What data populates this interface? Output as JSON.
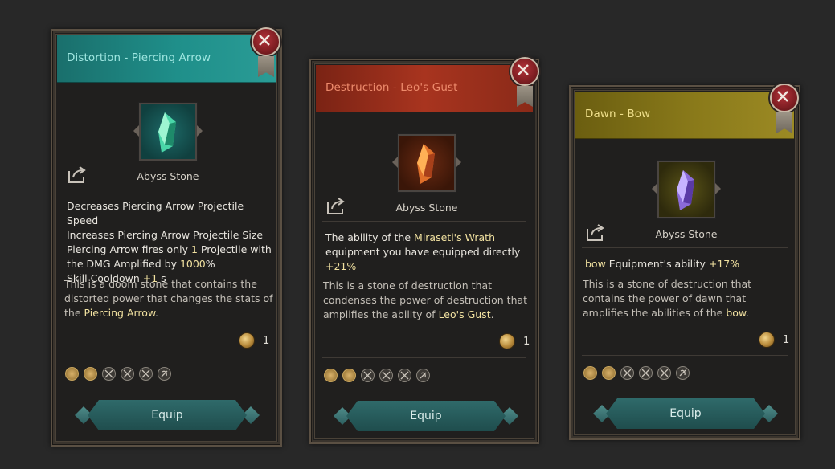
{
  "cards": [
    {
      "title": "Distortion - Piercing Arrow",
      "item_name": "Abyss Stone",
      "effect_lines": [
        "Decreases Piercing Arrow Projectile Speed",
        "Increases Piercing Arrow Projectile Size",
        "Piercing Arrow fires only ",
        "1",
        " Projectile with",
        "the DMG Amplified by ",
        "1000",
        "%",
        "Skill Cooldown ",
        "+1",
        " s"
      ],
      "description_parts": [
        "This is a doom stone that contains the distorted power that changes the stats of the ",
        "Piercing Arrow",
        "."
      ],
      "cost": "1",
      "equip_label": "Equip",
      "theme_color": "#1f8f8f",
      "title_color": "#9ee6e0"
    },
    {
      "title": "Destruction - Leo's Gust",
      "item_name": "Abyss Stone",
      "effect_parts": [
        "The ability of the ",
        "Miraseti's Wrath",
        " equipment you have equipped directly ",
        "+21%"
      ],
      "description_parts": [
        "This is a stone of destruction that condenses the power of destruction that amplifies the ability of ",
        "Leo's Gust",
        "."
      ],
      "cost": "1",
      "equip_label": "Equip",
      "theme_color": "#a8341f",
      "title_color": "#ee8b6c"
    },
    {
      "title": "Dawn - Bow",
      "item_name": "Abyss Stone",
      "effect_parts": [
        "bow",
        " Equipment's ability ",
        "+17%"
      ],
      "description_parts": [
        "This is a stone of destruction that contains the power of dawn that amplifies the abilities of the ",
        "bow",
        "."
      ],
      "cost": "1",
      "equip_label": "Equip",
      "theme_color": "#8a7a1a",
      "title_color": "#f0e08c"
    }
  ],
  "class_icons": [
    "gold-fist-icon",
    "gold-gauntlet-icon",
    "crossed-swords-icon",
    "crossed-axes-icon",
    "crossed-daggers-icon",
    "bow-icon"
  ]
}
